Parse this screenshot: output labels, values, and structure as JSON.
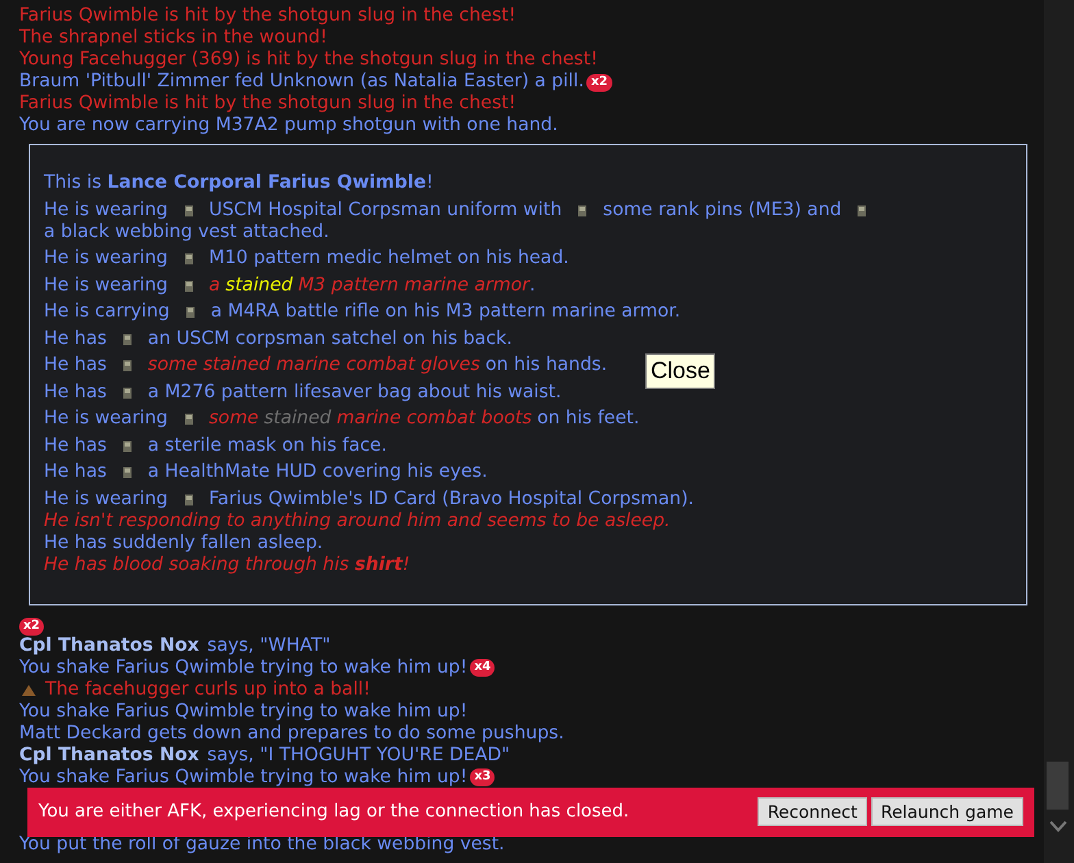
{
  "log_top": [
    {
      "kind": "danger",
      "text": "Farius Qwimble is hit by the shotgun slug in the chest!"
    },
    {
      "kind": "danger",
      "text": "The shrapnel sticks in the wound!"
    },
    {
      "kind": "danger",
      "text": "Young Facehugger (369) is hit by the shotgun slug in the chest!"
    },
    {
      "kind": "info",
      "text": "Braum 'Pitbull' Zimmer fed Unknown (as Natalia Easter) a pill.",
      "count": "x2"
    },
    {
      "kind": "danger",
      "text": "Farius Qwimble is hit by the shotgun slug in the chest!"
    },
    {
      "kind": "info",
      "text": "You are now carrying M37A2 pump shotgun with one hand."
    }
  ],
  "examine": {
    "tooltip": "Close",
    "lines": [
      {
        "parts": [
          {
            "kind": "plain",
            "text": "This is **Lance Corporal Farius Qwimble**!"
          }
        ]
      },
      {
        "parts": [
          {
            "kind": "plain",
            "text": "He is wearing"
          },
          {
            "kind": "icon"
          },
          {
            "kind": "plain",
            "text": "USCM Hospital Corpsman uniform with"
          },
          {
            "kind": "icon"
          },
          {
            "kind": "plain",
            "text": "some rank pins (ME3) and"
          },
          {
            "kind": "icon"
          },
          {
            "kind": "plain",
            "text": "a black webbing vest attached."
          }
        ]
      },
      {
        "parts": [
          {
            "kind": "plain",
            "text": "He is wearing"
          },
          {
            "kind": "icon"
          },
          {
            "kind": "plain",
            "text": "M10 pattern medic helmet on his head."
          }
        ]
      },
      {
        "parts": [
          {
            "kind": "plain",
            "text": "He is wearing"
          },
          {
            "kind": "icon"
          },
          {
            "kind": "item",
            "text": "a"
          },
          {
            "kind": "stain",
            "color": "#e8f000",
            "text": "stained"
          },
          {
            "kind": "item",
            "text": "M3 pattern marine armor"
          },
          {
            "kind": "tail",
            "text": "."
          }
        ]
      },
      {
        "parts": [
          {
            "kind": "plain",
            "text": "He is carrying"
          },
          {
            "kind": "icon"
          },
          {
            "kind": "plain",
            "text": "a M4RA battle rifle on his M3 pattern marine armor."
          }
        ]
      },
      {
        "parts": [
          {
            "kind": "plain",
            "text": "He has"
          },
          {
            "kind": "icon"
          },
          {
            "kind": "plain",
            "text": "an USCM corpsman satchel on his back."
          }
        ]
      },
      {
        "parts": [
          {
            "kind": "plain",
            "text": "He has"
          },
          {
            "kind": "icon"
          },
          {
            "kind": "item",
            "text": "some stained marine combat gloves"
          },
          {
            "kind": "plain",
            "text": "on his hands."
          }
        ]
      },
      {
        "parts": [
          {
            "kind": "plain",
            "text": "He has"
          },
          {
            "kind": "icon"
          },
          {
            "kind": "plain",
            "text": "a M276 pattern lifesaver bag about his waist."
          }
        ]
      },
      {
        "parts": [
          {
            "kind": "plain",
            "text": "He is wearing"
          },
          {
            "kind": "icon"
          },
          {
            "kind": "item",
            "text": "some"
          },
          {
            "kind": "stain",
            "color": "#6e6e6e",
            "text": "stained"
          },
          {
            "kind": "item",
            "text": "marine combat boots"
          },
          {
            "kind": "plain",
            "text": "on his feet."
          }
        ]
      },
      {
        "parts": [
          {
            "kind": "plain",
            "text": "He has"
          },
          {
            "kind": "icon"
          },
          {
            "kind": "plain",
            "text": "a sterile mask on his face."
          }
        ]
      },
      {
        "parts": [
          {
            "kind": "plain",
            "text": "He has"
          },
          {
            "kind": "icon"
          },
          {
            "kind": "plain",
            "text": "a HealthMate HUD covering his eyes."
          }
        ]
      },
      {
        "parts": [
          {
            "kind": "plain",
            "text": "He is wearing"
          },
          {
            "kind": "icon"
          },
          {
            "kind": "plain",
            "text": "Farius Qwimble's ID Card (Bravo Hospital Corpsman)."
          }
        ]
      }
    ],
    "notes": [
      {
        "kind": "item",
        "text": "He isn't responding to anything around him and seems to be asleep."
      },
      {
        "kind": "plain",
        "text": "He has suddenly fallen asleep."
      },
      {
        "kind": "item",
        "text": "He has blood soaking through his **shirt**!"
      }
    ]
  },
  "log_bottom": [
    {
      "kind": "badge",
      "count": "x2"
    },
    {
      "kind": "say",
      "speaker": "Cpl Thanatos Nox",
      "text": "says, \"WHAT\""
    },
    {
      "kind": "info",
      "text": "You shake Farius Qwimble trying to wake him up!",
      "count": "x4"
    },
    {
      "kind": "danger",
      "icon": true,
      "text": "The facehugger curls up into a ball!"
    },
    {
      "kind": "info",
      "text": "You shake Farius Qwimble trying to wake him up!"
    },
    {
      "kind": "info",
      "text": "Matt Deckard gets down and prepares to do some pushups."
    },
    {
      "kind": "say",
      "speaker": "Cpl Thanatos Nox",
      "text": "says, \"I THOGUHT YOU'RE DEAD\""
    },
    {
      "kind": "info",
      "text": "You shake Farius Qwimble trying to wake him up!",
      "count": "x3"
    }
  ],
  "banner": {
    "message": "You are either AFK, experiencing lag or the connection has closed.",
    "buttons": [
      "Reconnect",
      "Relaunch game"
    ]
  },
  "log_last": [
    {
      "kind": "info",
      "text": "You put the roll of gauze into the black webbing vest."
    }
  ]
}
